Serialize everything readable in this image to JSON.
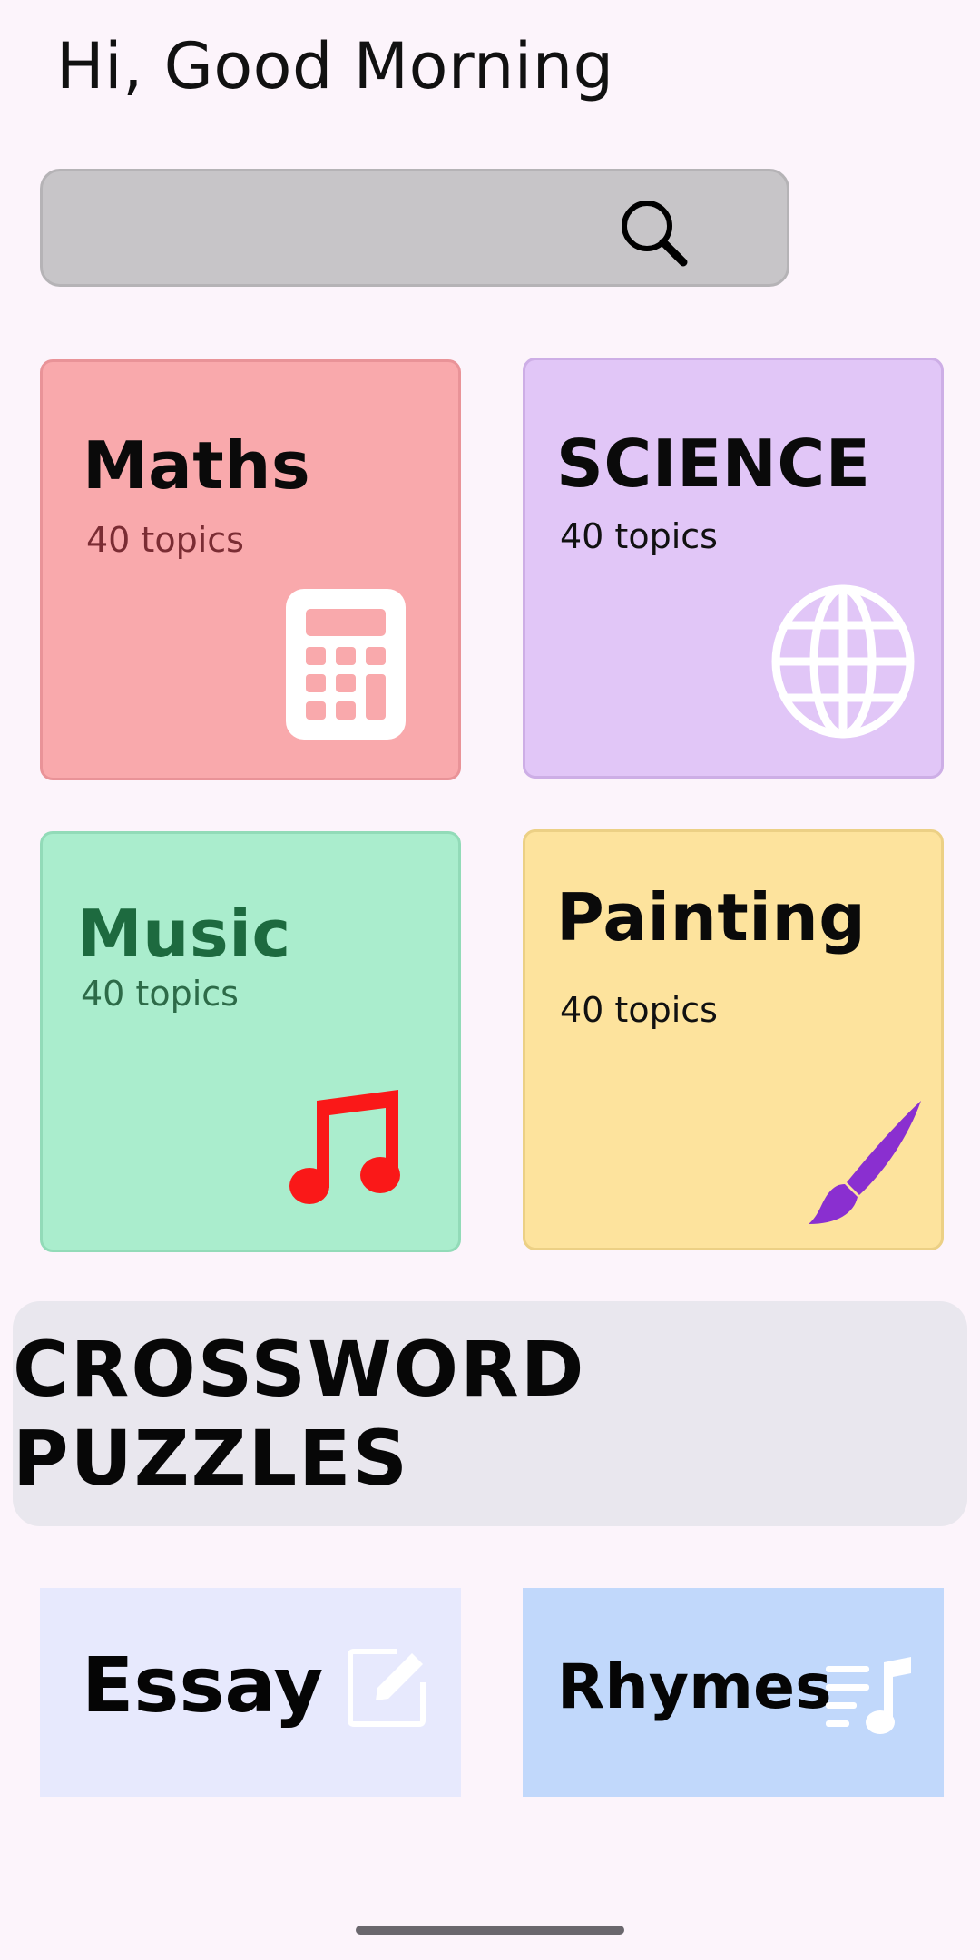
{
  "greeting": "Hi, Good Morning",
  "search": {
    "placeholder": ""
  },
  "categories": [
    {
      "title": "Maths",
      "subtitle": "40 topics",
      "icon": "calculator-icon"
    },
    {
      "title": "SCIENCE",
      "subtitle": "40 topics",
      "icon": "globe-icon"
    },
    {
      "title": "Music",
      "subtitle": "40 topics",
      "icon": "music-note-icon"
    },
    {
      "title": "Painting",
      "subtitle": "40 topics",
      "icon": "paintbrush-icon"
    }
  ],
  "crossword": {
    "label": "CROSSWORD PUZZLES"
  },
  "extras": [
    {
      "label": "Essay",
      "icon": "edit-note-icon"
    },
    {
      "label": "Rhymes",
      "icon": "music-list-icon"
    }
  ],
  "colors": {
    "background": "#fcf4fb",
    "maths": "#f9a9ac",
    "science": "#e1c6f7",
    "music": "#aaedcd",
    "painting": "#fde39d",
    "crossword": "#e9e7ee",
    "essay": "#e7e9fd",
    "rhymes": "#c1d8fb",
    "music_icon": "#fa1818",
    "brush_icon": "#8a2fd0"
  }
}
